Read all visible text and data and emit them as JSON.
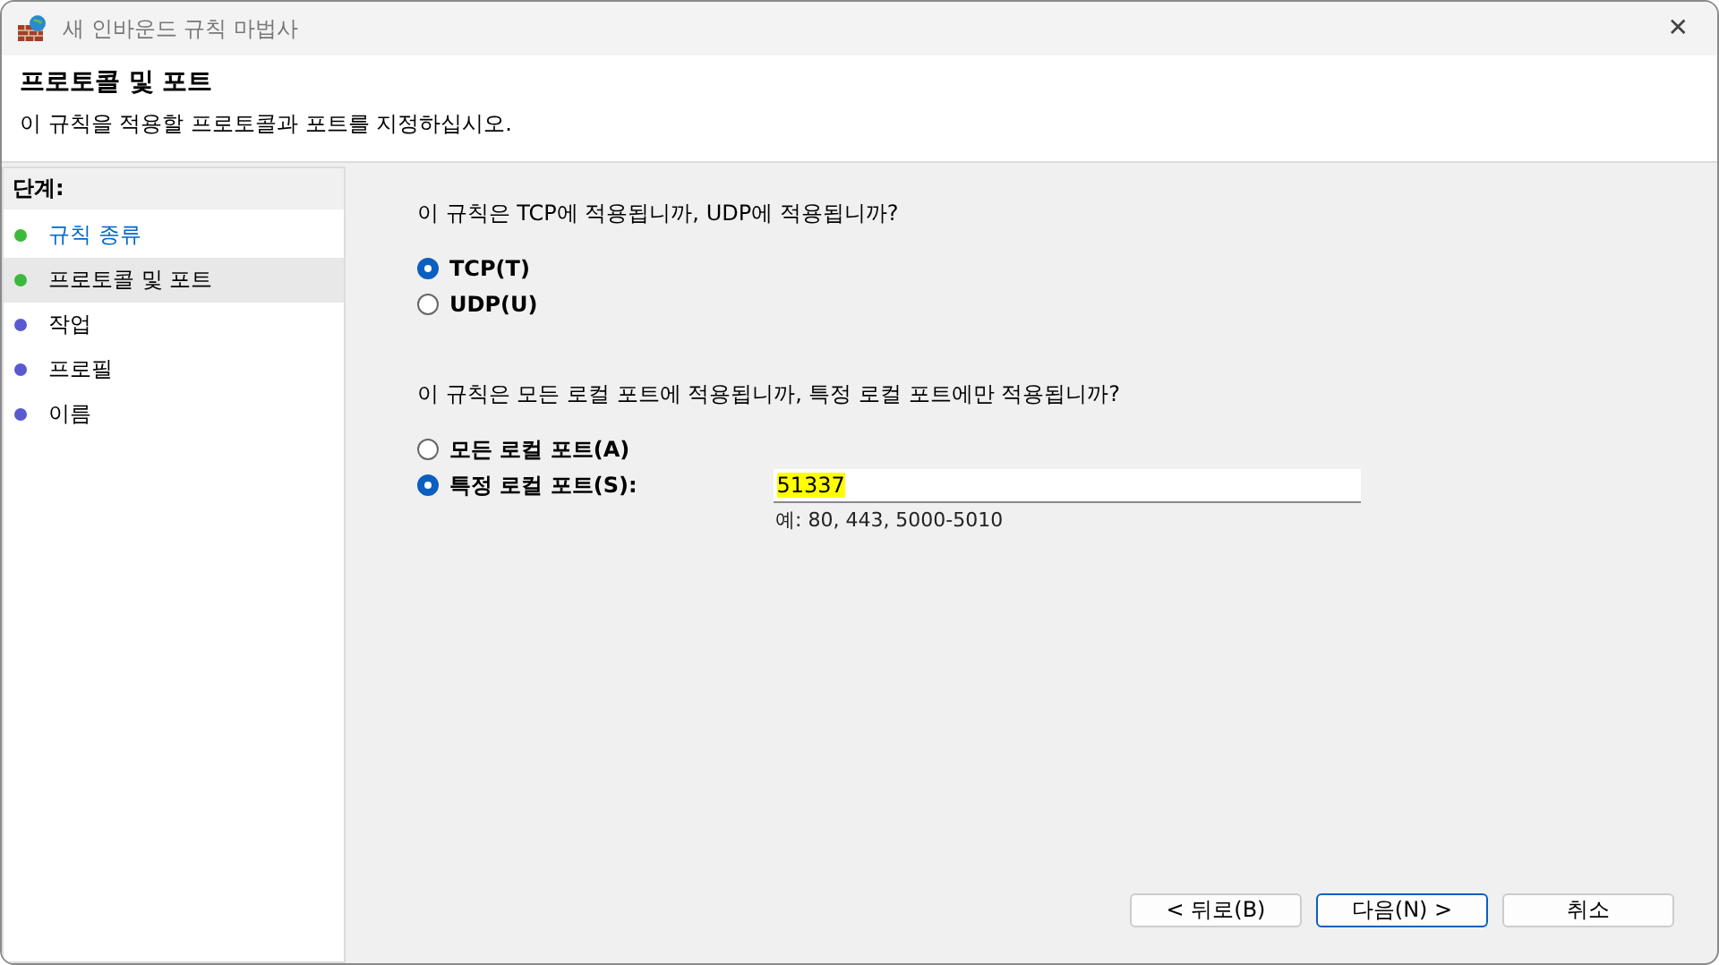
{
  "window": {
    "title": "새 인바운드 규칙 마법사",
    "close": "✕"
  },
  "header": {
    "title": "프로토콜 및 포트",
    "description": "이 규칙을 적용할 프로토콜과 포트를 지정하십시오."
  },
  "steps": {
    "heading": "단계:",
    "items": [
      {
        "label": "규칙 종류",
        "color": "#3cb83c",
        "selected": false,
        "link": true
      },
      {
        "label": "프로토콜 및 포트",
        "color": "#3cb83c",
        "selected": true,
        "link": false
      },
      {
        "label": "작업",
        "color": "#5a5ad0",
        "selected": false,
        "link": false
      },
      {
        "label": "프로필",
        "color": "#5a5ad0",
        "selected": false,
        "link": false
      },
      {
        "label": "이름",
        "color": "#5a5ad0",
        "selected": false,
        "link": false
      }
    ]
  },
  "protocol": {
    "question": "이 규칙은 TCP에 적용됩니까, UDP에 적용됩니까?",
    "options": [
      {
        "label": "TCP(T)",
        "selected": true
      },
      {
        "label": "UDP(U)",
        "selected": false
      }
    ]
  },
  "ports": {
    "question": "이 규칙은 모든 로컬 포트에 적용됩니까, 특정 로컬 포트에만 적용됩니까?",
    "options": [
      {
        "label": "모든 로컬 포트(A)",
        "selected": false
      },
      {
        "label": "특정 로컬 포트(S):",
        "selected": true
      }
    ],
    "value": "51337",
    "hint": "예: 80, 443, 5000-5010"
  },
  "buttons": [
    {
      "label": "< 뒤로(B)",
      "default": false
    },
    {
      "label": "다음(N) >",
      "default": true
    },
    {
      "label": "취소",
      "default": false
    }
  ]
}
